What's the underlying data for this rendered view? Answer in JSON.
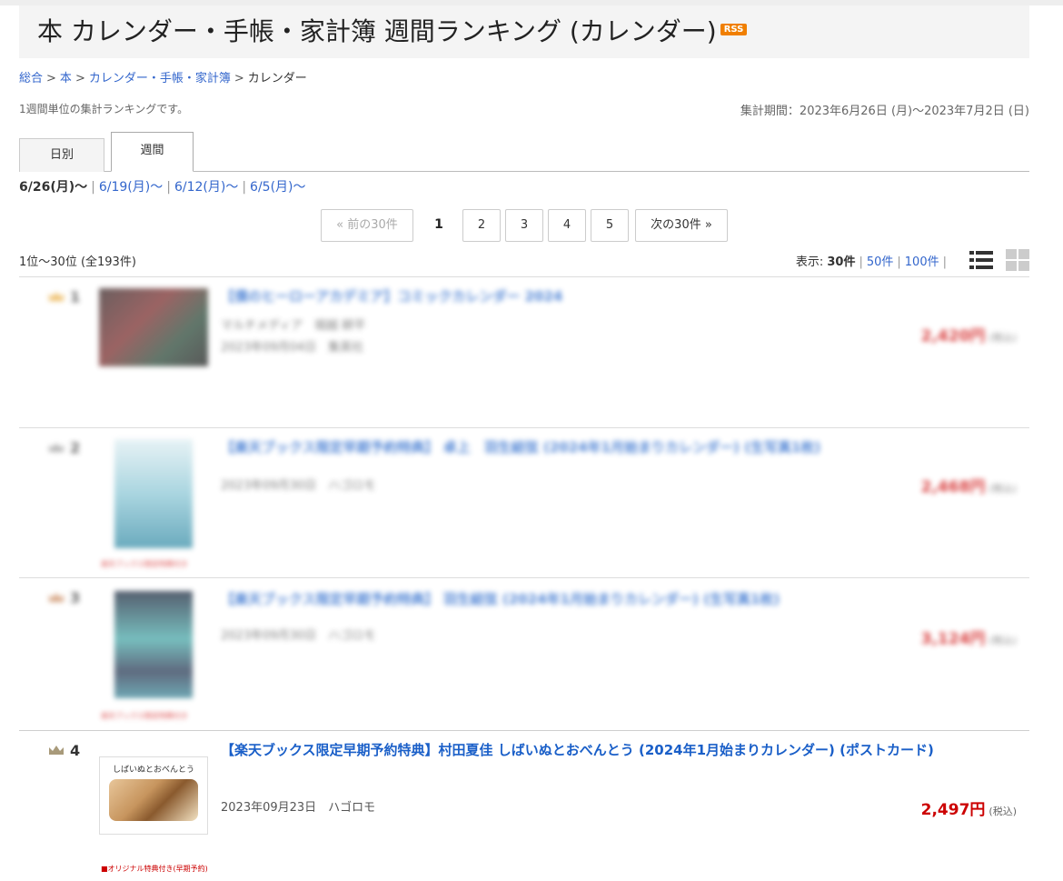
{
  "header": {
    "title": "本 カレンダー・手帳・家計簿 週間ランキング (カレンダー)",
    "rss_label": "RSS"
  },
  "breadcrumb": {
    "items": [
      "総合",
      "本",
      "カレンダー・手帳・家計簿"
    ],
    "current": "カレンダー",
    "separator": ">"
  },
  "description": "1週間単位の集計ランキングです。",
  "period": "集計期間：2023年6月26日 (月)〜2023年7月2日 (日)",
  "tabs": [
    {
      "label": "日別",
      "active": false
    },
    {
      "label": "週間",
      "active": true
    }
  ],
  "weeks": {
    "current": "6/26(月)〜",
    "others": [
      "6/19(月)〜",
      "6/12(月)〜",
      "6/5(月)〜"
    ]
  },
  "pager": {
    "prev": "« 前の30件",
    "current": "1",
    "pages": [
      "2",
      "3",
      "4",
      "5"
    ],
    "next": "次の30件 »"
  },
  "result_count": "1位〜30位 (全193件)",
  "display": {
    "label": "表示:",
    "current": "30件",
    "options": [
      "50件",
      "100件"
    ],
    "trailing_sep": "|"
  },
  "items": [
    {
      "rank": "1",
      "title": "【僕のヒーローアカデミア】コミックカレンダー 2024",
      "meta1": "マルチメディア　堀越 耕平",
      "meta2": "2023年09月04日　集英社",
      "price": "2,420円",
      "tax": "(税込)",
      "crown_color": "#e8a93a"
    },
    {
      "rank": "2",
      "title": "【楽天ブックス限定早期予約特典】 卓上　羽生結弦 (2024年1月始まりカレンダー) (生写真1枚)",
      "meta1": "2023年09月30日　ハゴロモ",
      "price": "2,468円",
      "tax": "(税込)",
      "badge": "楽天ブックス限定特典付き",
      "crown_color": "#9a9a9a"
    },
    {
      "rank": "3",
      "title": "【楽天ブックス限定早期予約特典】 羽生結弦 (2024年1月始まりカレンダー) (生写真1枚)",
      "meta1": "2023年09月30日　ハゴロモ",
      "price": "3,124円",
      "tax": "(税込)",
      "badge": "楽天ブックス限定特典付き",
      "crown_color": "#c8865a"
    },
    {
      "rank": "4",
      "title": "【楽天ブックス限定早期予約特典】村田夏佳 しばいぬとおべんとう (2024年1月始まりカレンダー) (ポストカード)",
      "meta1": "2023年09月23日　ハゴロモ",
      "price": "2,497円",
      "tax": "(税込)",
      "badge": "■オリジナル特典付き(早期予約)",
      "thumb_text": "しばいぬとおべんとう",
      "crown_color": "#a89a7a"
    }
  ]
}
